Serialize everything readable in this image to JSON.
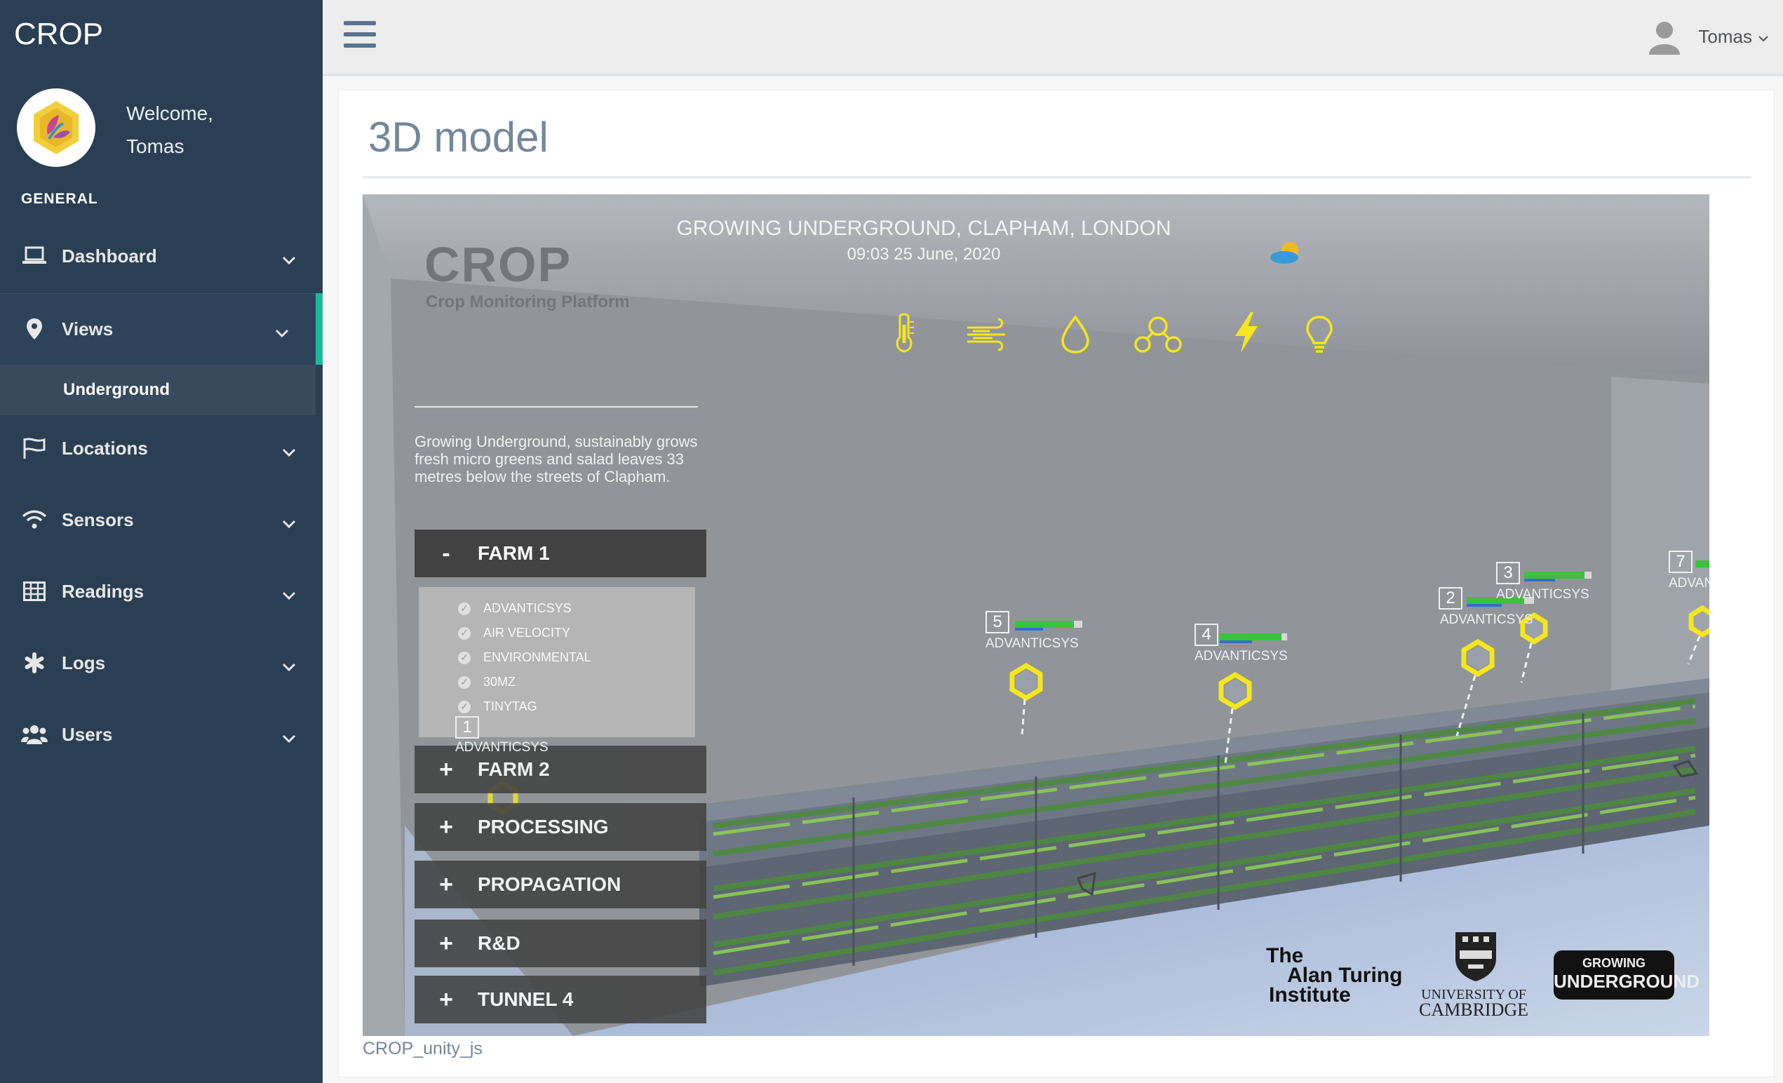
{
  "app": {
    "brand": "CROP"
  },
  "profile": {
    "welcome": "Welcome,",
    "name": "Tomas"
  },
  "nav": {
    "section": "GENERAL",
    "items": [
      {
        "label": "Dashboard",
        "icon": "laptop-icon"
      },
      {
        "label": "Views",
        "icon": "map-marker-icon",
        "active": true
      },
      {
        "label": "Locations",
        "icon": "flag-icon"
      },
      {
        "label": "Sensors",
        "icon": "wifi-icon"
      },
      {
        "label": "Readings",
        "icon": "table-icon"
      },
      {
        "label": "Logs",
        "icon": "asterisk-icon"
      },
      {
        "label": "Users",
        "icon": "users-icon"
      }
    ],
    "sub_item": "Underground"
  },
  "topbar": {
    "user": "Tomas"
  },
  "page": {
    "title": "3D model",
    "caption": "CROP_unity_js"
  },
  "viewer": {
    "location": "GROWING UNDERGROUND, CLAPHAM, LONDON",
    "time": "09:03 25 June, 2020",
    "brand": "CROP",
    "brand_sub": "Crop Monitoring Platform",
    "description": "Growing Underground, sustainably grows fresh micro greens and salad leaves 33 metres below the  streets of Clapham.",
    "sections": [
      {
        "sign": "-",
        "label": "FARM 1"
      },
      {
        "sign": "+",
        "label": "FARM 2"
      },
      {
        "sign": "+",
        "label": "PROCESSING"
      },
      {
        "sign": "+",
        "label": "PROPAGATION"
      },
      {
        "sign": "+",
        "label": "R&D"
      },
      {
        "sign": "+",
        "label": "TUNNEL 4"
      }
    ],
    "sensor_types": [
      "ADVANTICSYS",
      "AIR VELOCITY",
      "ENVIRONMENTAL",
      "30MZ",
      "TINYTAG"
    ],
    "markers": [
      {
        "id": "1",
        "label": "ADVANTICSYS"
      },
      {
        "id": "2",
        "label": "ADVANTICSYS"
      },
      {
        "id": "3",
        "label": "ADVANTICSYS"
      },
      {
        "id": "4",
        "label": "ADVANTICSYS"
      },
      {
        "id": "5",
        "label": "ADVANTICSYS"
      },
      {
        "id": "7",
        "label": "ADVAN"
      }
    ],
    "logos": {
      "turing_1": "The",
      "turing_2": "Alan Turing",
      "turing_3": "Institute",
      "cam_1": "UNIVERSITY OF",
      "cam_2": "CAMBRIDGE",
      "gu_1": "GROWING",
      "gu_2": "UNDERGROUND"
    }
  },
  "colors": {
    "sidebar": "#2a3f54",
    "accent": "#1abb9c",
    "icon_yellow": "#f5e61e"
  }
}
